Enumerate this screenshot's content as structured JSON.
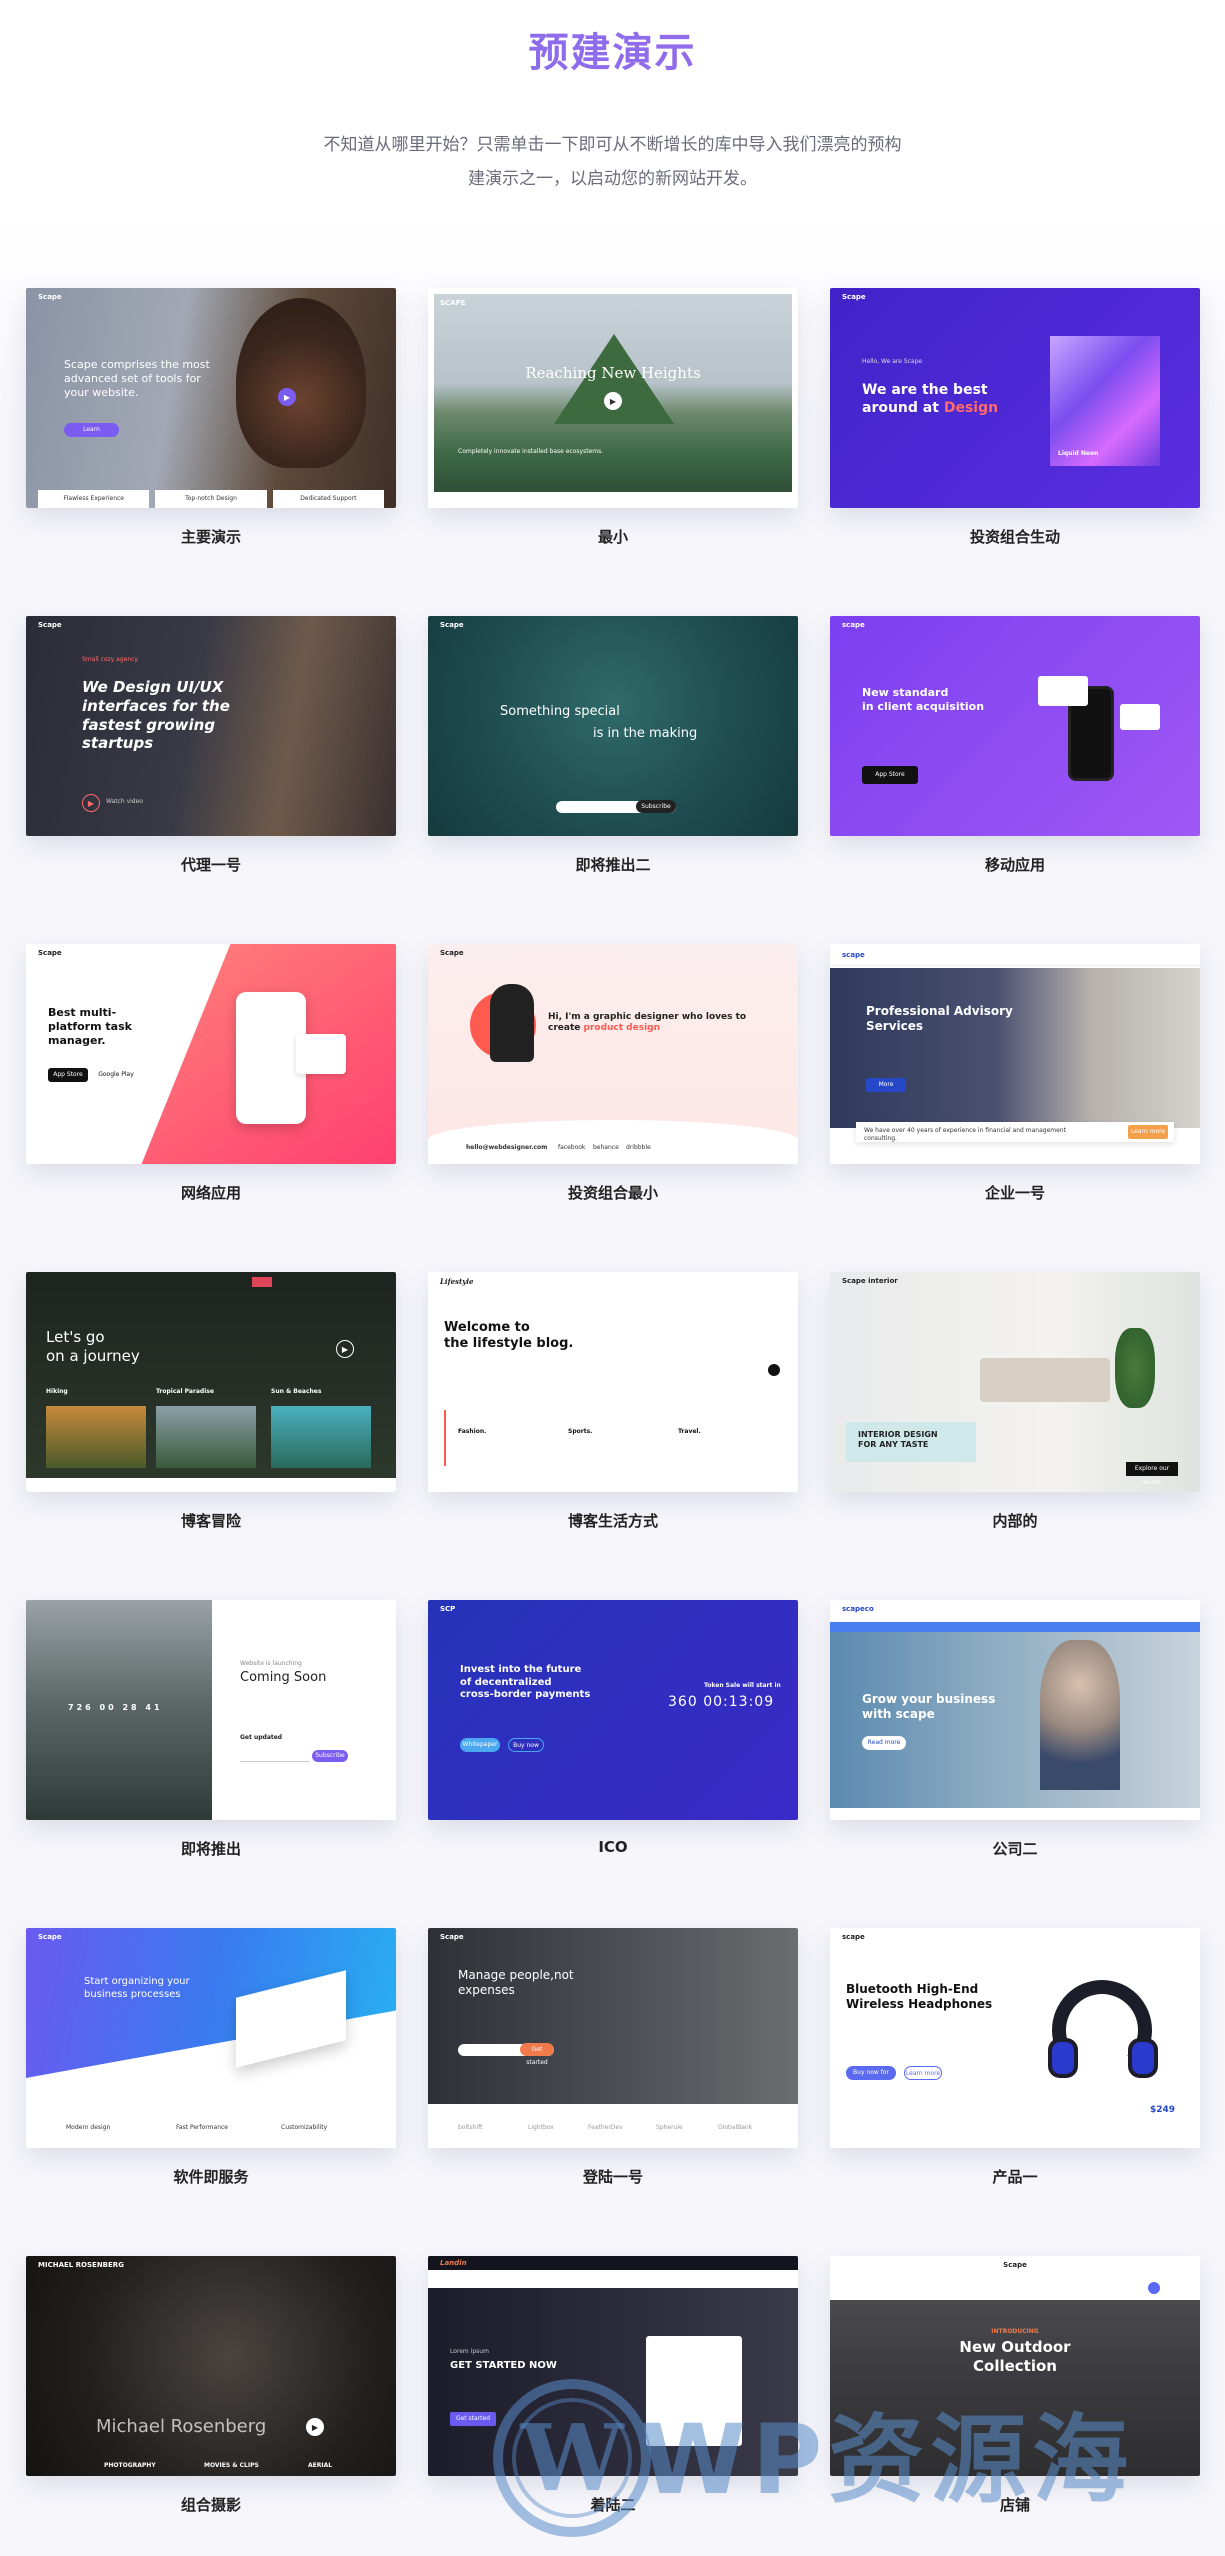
{
  "header": {
    "title": "预建演示",
    "intro_line1": "不知道从哪里开始？只需单击一下即可从不断增长的库中导入我们漂亮的预构",
    "intro_line2": "建演示之一，以启动您的新网站开发。"
  },
  "demos": [
    {
      "label": "主要演示",
      "thumb": {
        "brand": "Scape",
        "headline": "Scape comprises the most advanced set of tools for your website.",
        "features": [
          "Flawless Experience",
          "Top-notch Design",
          "Dedicated Support"
        ]
      }
    },
    {
      "label": "最小",
      "thumb": {
        "brand": "SCAPE",
        "headline": "Reaching New Heights",
        "sub": "Completely innovate installed base ecosystems."
      }
    },
    {
      "label": "投资组合生动",
      "thumb": {
        "brand": "Scape",
        "kicker": "Hello, We are Scape",
        "headline1": "We are the best",
        "headline2": "around at",
        "accent": "Design",
        "card": "Liquid Neon"
      }
    },
    {
      "label": "代理一号",
      "thumb": {
        "brand": "Scape",
        "kicker": "Small cozy agency",
        "headline": "We Design UI/UX interfaces for the fastest growing startups",
        "watch": "Watch video"
      }
    },
    {
      "label": "即将推出二",
      "thumb": {
        "brand": "Scape",
        "line1": "Something special",
        "line2": "is in the making",
        "cta": "Subscribe"
      }
    },
    {
      "label": "移动应用",
      "thumb": {
        "brand": "scape",
        "headline1": "New standard",
        "headline2": "in client acquisition",
        "store": "App Store"
      }
    },
    {
      "label": "网络应用",
      "thumb": {
        "brand": "Scape",
        "headline": "Best multi-platform task manager.",
        "store1": "App Store",
        "store2": "Google Play"
      }
    },
    {
      "label": "投资组合最小",
      "thumb": {
        "brand": "Scape",
        "headline1": "Hi, I'm a graphic designer who loves to",
        "headline2": "create",
        "accent": "product design",
        "email": "hello@webdesigner.com",
        "links": [
          "facebook",
          "behance",
          "dribbble"
        ]
      }
    },
    {
      "label": "企业一号",
      "thumb": {
        "brand": "scape",
        "headline1": "Professional Advisory",
        "headline2": "Services",
        "footer": "We have over 40 years of experience in financial and management consulting.",
        "cta": "Learn more"
      }
    },
    {
      "label": "博客冒险",
      "thumb": {
        "headline1": "Let's go",
        "headline2": "on a journey",
        "posts": [
          "Hiking",
          "Tropical Paradise",
          "Sun & Beaches"
        ]
      }
    },
    {
      "label": "博客生活方式",
      "thumb": {
        "brand": "Lifestyle",
        "headline1": "Welcome to",
        "headline2": "the lifestyle blog.",
        "cats": [
          "Fashion.",
          "Sports.",
          "Travel."
        ]
      }
    },
    {
      "label": "内部的",
      "thumb": {
        "brand": "Scape interior",
        "headline1": "INTERIOR DESIGN",
        "headline2": "FOR ANY TASTE",
        "cta": "Explore our works"
      }
    },
    {
      "label": "即将推出",
      "thumb": {
        "kicker": "Website is launching",
        "headline": "Coming Soon",
        "countdown": [
          "726",
          "00",
          "28",
          "41"
        ],
        "cta": "Subscribe",
        "field": "Get updated"
      }
    },
    {
      "label": "ICO",
      "thumb": {
        "brand": "SCP",
        "headline1": "Invest into the future",
        "headline2": "of decentralized",
        "headline3": "cross-border payments",
        "timer_label": "Token Sale will start in",
        "timer": [
          "360",
          "00",
          "13",
          "09"
        ],
        "btn1": "Whitepaper",
        "btn2": "Buy now"
      }
    },
    {
      "label": "公司二",
      "thumb": {
        "brand": "scapeco",
        "headline1": "Grow your business",
        "headline2": "with scape",
        "cta": "Read more"
      }
    },
    {
      "label": "软件即服务",
      "thumb": {
        "brand": "Scape",
        "headline1": "Start organizing your",
        "headline2": "business processes",
        "features": [
          "Modern design",
          "Fast Performance",
          "Customizability"
        ]
      }
    },
    {
      "label": "登陆一号",
      "thumb": {
        "brand": "Scape",
        "headline1": "Manage people,not",
        "headline2": "expenses",
        "cta": "Get started",
        "logos": [
          "boltshift",
          "Lightbox",
          "FeatherDev",
          "Spherule",
          "GlobalBank"
        ]
      }
    },
    {
      "label": "产品一",
      "thumb": {
        "brand": "scape",
        "headline1": "Bluetooth High-End",
        "headline2": "Wireless Headphones",
        "btn1": "Buy now for $249",
        "btn2": "Learn more",
        "price": "$249"
      }
    },
    {
      "label": "组合摄影",
      "thumb": {
        "brand": "MICHAEL ROSENBERG",
        "name": "Michael Rosenberg",
        "cats": [
          "PHOTOGRAPHY",
          "MOVIES & CLIPS",
          "AERIAL"
        ]
      }
    },
    {
      "label": "着陆二",
      "thumb": {
        "brand": "Landin",
        "kicker": "Lorem ipsum",
        "headline": "GET STARTED NOW",
        "cta": "Get started"
      }
    },
    {
      "label": "店铺",
      "thumb": {
        "brand": "Scape",
        "kicker": "INTRODUCING",
        "headline1": "New Outdoor",
        "headline2": "Collection"
      }
    }
  ],
  "colors": {
    "accent": "#8b5cf6",
    "purple": "#5b2ee0",
    "blue": "#2747c9",
    "coral": "#ff5a6a"
  },
  "watermark": {
    "text": "WP资源海",
    "icon": "wordpress-logo-icon"
  }
}
